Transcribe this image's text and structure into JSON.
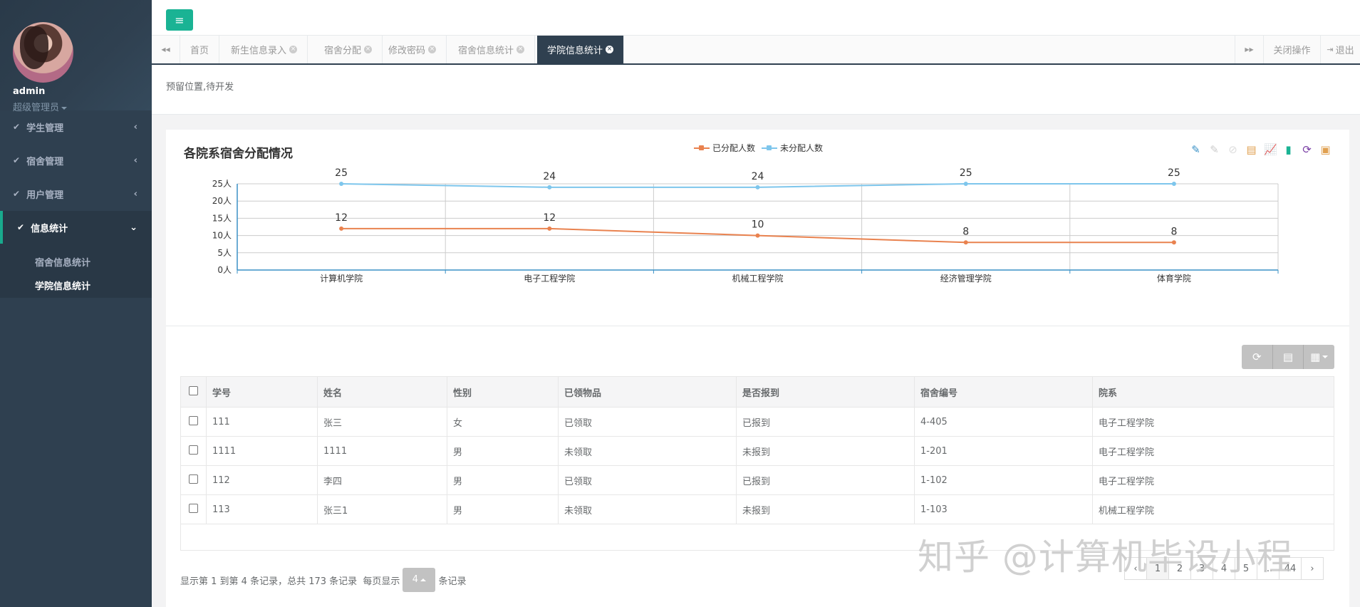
{
  "sidebar": {
    "profile": {
      "name": "admin",
      "role": "超级管理员"
    },
    "menu": [
      {
        "label": "学生管理"
      },
      {
        "label": "宿舍管理"
      },
      {
        "label": "用户管理"
      },
      {
        "label": "信息统计"
      }
    ],
    "submenu": [
      {
        "label": "宿舍信息统计"
      },
      {
        "label": "学院信息统计"
      }
    ],
    "icons": {
      "check": "✔",
      "collapsed_arrow": "‹",
      "expanded_arrow": "⌄"
    }
  },
  "topbar": {
    "menu_icon": "≡"
  },
  "tabs": {
    "prev_icon": "◀◀",
    "next_icon": "▶▶",
    "items": [
      {
        "label": "首页",
        "closable": false
      },
      {
        "label": "新生信息录入",
        "closable": true
      },
      {
        "label": "宿舍分配",
        "closable": true
      },
      {
        "label": "修改密码",
        "closable": true
      },
      {
        "label": "宿舍信息统计",
        "closable": true
      },
      {
        "label": "学院信息统计",
        "closable": true,
        "active": true
      }
    ],
    "close_ops": "关闭操作",
    "logout": "退出",
    "close_symbol": "×"
  },
  "notice": {
    "text": "预留位置,待开发"
  },
  "chart_data": {
    "type": "line",
    "title": "各院系宿舍分配情况",
    "categories": [
      "计算机学院",
      "电子工程学院",
      "机械工程学院",
      "经济管理学院",
      "体育学院"
    ],
    "series": [
      {
        "name": "已分配人数",
        "values": [
          12,
          12,
          10,
          8,
          8
        ],
        "color": "#e9824f"
      },
      {
        "name": "未分配人数",
        "values": [
          25,
          24,
          24,
          25,
          25
        ],
        "color": "#7ec6ec"
      }
    ],
    "ylim": [
      0,
      25
    ],
    "yticks": [
      0,
      5,
      10,
      15,
      20,
      25
    ],
    "ytick_suffix": "人",
    "grid": true,
    "legend_position": "top-center"
  },
  "toolbox": [
    {
      "name": "mark-icon",
      "glyph": "✎",
      "color": "#3a91c6"
    },
    {
      "name": "mark-undo-icon",
      "glyph": "✎",
      "color": "#ccc"
    },
    {
      "name": "mark-clear-icon",
      "glyph": "⊘",
      "color": "#ddd"
    },
    {
      "name": "data-view-icon",
      "glyph": "▤",
      "color": "#e0a050"
    },
    {
      "name": "line-chart-icon",
      "glyph": "📈",
      "color": "#1ab394"
    },
    {
      "name": "bar-chart-icon",
      "glyph": "▮",
      "color": "#1ab394"
    },
    {
      "name": "restore-icon",
      "glyph": "⟳",
      "color": "#7a3fa5"
    },
    {
      "name": "save-image-icon",
      "glyph": "▣",
      "color": "#e0a050"
    }
  ],
  "table": {
    "tools": {
      "refresh": "⟳",
      "toggle": "▤",
      "columns": "▦"
    },
    "columns": [
      "学号",
      "姓名",
      "性别",
      "已领物品",
      "是否报到",
      "宿舍编号",
      "院系"
    ],
    "rows": [
      [
        "111",
        "张三",
        "女",
        "已领取",
        "已报到",
        "4-405",
        "电子工程学院"
      ],
      [
        "1111",
        "1111",
        "男",
        "未领取",
        "未报到",
        "1-201",
        "电子工程学院"
      ],
      [
        "112",
        "李四",
        "男",
        "已领取",
        "已报到",
        "1-102",
        "电子工程学院"
      ],
      [
        "113",
        "张三1",
        "男",
        "未领取",
        "未报到",
        "1-103",
        "机械工程学院"
      ]
    ]
  },
  "pagination": {
    "info": "显示第 1 到第 4 条记录，总共 173 条记录",
    "per_page_prefix": "每页显示",
    "per_page_value": "4",
    "per_page_suffix": "条记录",
    "pages": [
      "‹",
      "1",
      "2",
      "3",
      "4",
      "5",
      "...",
      "44",
      "›"
    ],
    "current": "1"
  },
  "watermark": "知乎 @计算机毕设小程"
}
